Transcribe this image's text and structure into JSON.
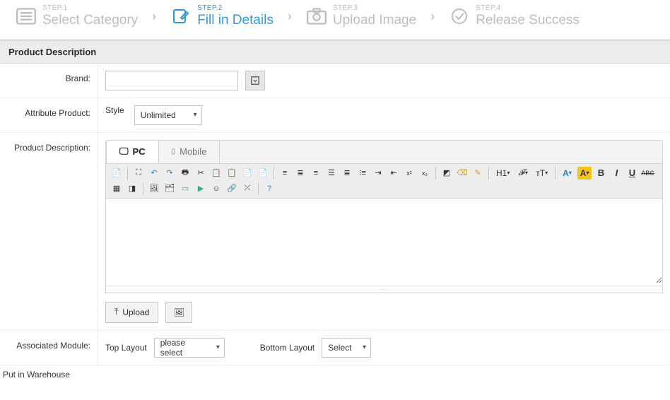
{
  "steps": {
    "s1": {
      "num": "STEP.1",
      "name": "Select Category"
    },
    "s2": {
      "num": "STEP.2",
      "name": "Fill in Details"
    },
    "s3": {
      "num": "STEP.3",
      "name": "Upload Image"
    },
    "s4": {
      "num": "STEP.4",
      "name": "Release Success"
    },
    "sep": "›"
  },
  "section_title": "Product Description",
  "brand": {
    "label": "Brand:",
    "value": ""
  },
  "attribute": {
    "label": "Attribute Product:",
    "style_label": "Style",
    "style_value": "Unlimited"
  },
  "description": {
    "label": "Product Description:",
    "tabs": {
      "pc": "PC",
      "mobile": "Mobile"
    },
    "editor_value": "",
    "upload_label": "Upload"
  },
  "toolbar": {
    "h1": "H1",
    "ff": "𝓕",
    "tt": "ᴛT",
    "a_color": "A",
    "a_bg": "A",
    "bold": "B",
    "italic": "I",
    "u": "U",
    "abc": "ABC"
  },
  "associated": {
    "label": "Associated Module:",
    "top_label": "Top Layout",
    "top_value": "please select",
    "bottom_label": "Bottom Layout",
    "bottom_value": "Select"
  },
  "footer_title": "Put in Warehouse"
}
